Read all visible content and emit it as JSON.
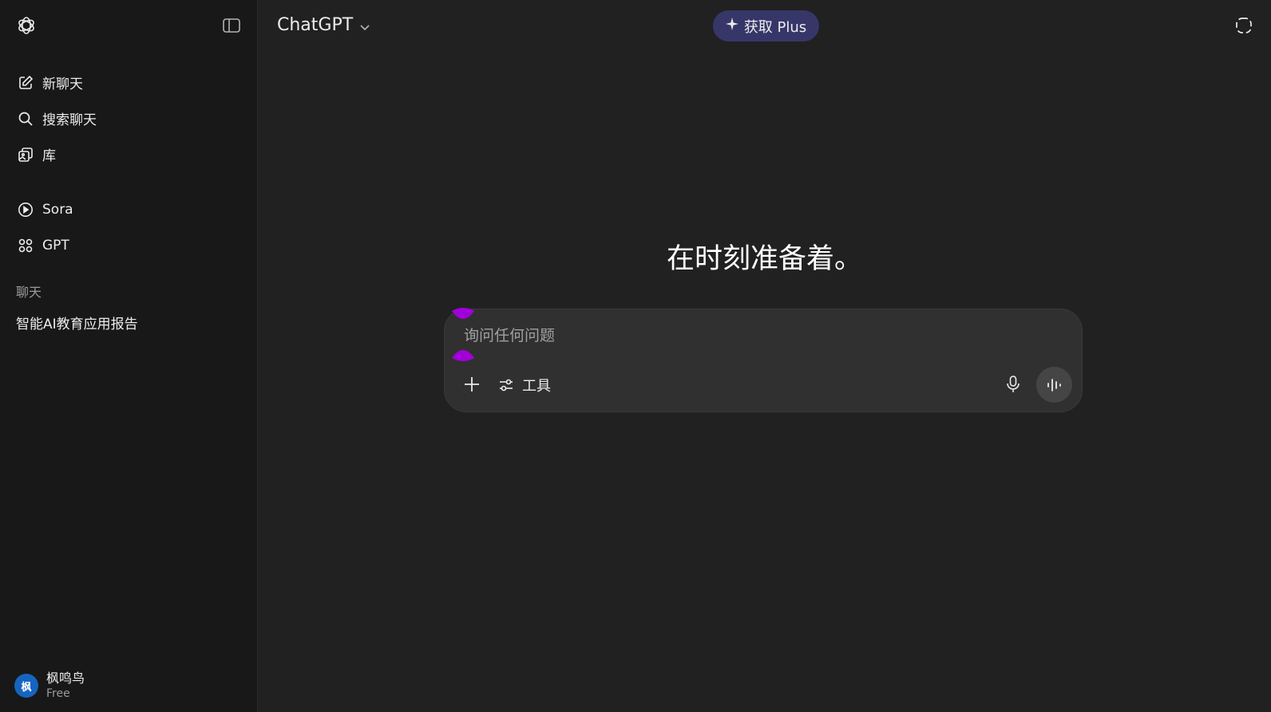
{
  "sidebar": {
    "nav_primary": [
      {
        "label": "新聊天",
        "icon": "new-chat-icon"
      },
      {
        "label": "搜索聊天",
        "icon": "search-icon"
      },
      {
        "label": "库",
        "icon": "library-icon"
      }
    ],
    "nav_secondary": [
      {
        "label": "Sora",
        "icon": "play-circle-icon"
      },
      {
        "label": "GPT",
        "icon": "grid-icon"
      }
    ],
    "section_label": "聊天",
    "chats": [
      "智能AI教育应用报告"
    ],
    "user": {
      "avatar_text": "枫",
      "name": "枫鸣鸟",
      "plan": "Free"
    }
  },
  "header": {
    "model": "ChatGPT",
    "upgrade_label": "获取 Plus"
  },
  "main": {
    "headline": "在时刻准备着。"
  },
  "composer": {
    "placeholder": "询问任何问题",
    "tools_label": "工具"
  },
  "colors": {
    "sidebar_bg": "#181818",
    "main_bg": "#212121",
    "composer_bg": "#303030",
    "plus_bg": "#373669",
    "avatar_bg": "#1565c0",
    "marker": "#a100d8"
  }
}
